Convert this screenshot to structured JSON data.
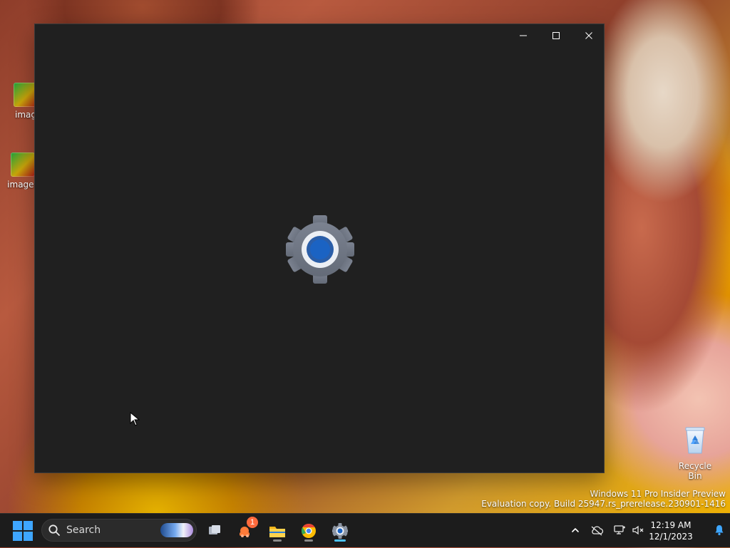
{
  "desktop": {
    "icons": [
      {
        "label": "imag"
      },
      {
        "label": "images"
      }
    ],
    "recycle_bin_label": "Recycle Bin",
    "watermark_line1": "Windows 11 Pro Insider Preview",
    "watermark_line2": "Evaluation copy. Build 25947.rs_prerelease.230901-1416"
  },
  "window": {
    "buttons": [
      "minimize",
      "maximize",
      "close"
    ],
    "splash_icon": "settings-gear-icon"
  },
  "taskbar": {
    "search_placeholder": "Search",
    "apps": [
      {
        "icon": "task-view-icon"
      },
      {
        "icon": "notifications-app-icon",
        "badge": "1"
      },
      {
        "icon": "file-explorer-icon"
      },
      {
        "icon": "chrome-icon"
      },
      {
        "icon": "settings-icon"
      }
    ],
    "tray": {
      "time": "12:19 AM",
      "date": "12/1/2023"
    }
  },
  "colors": {
    "accent": "#3ea6ff",
    "window_bg": "#202020",
    "taskbar_bg": "#1c1c1c"
  }
}
